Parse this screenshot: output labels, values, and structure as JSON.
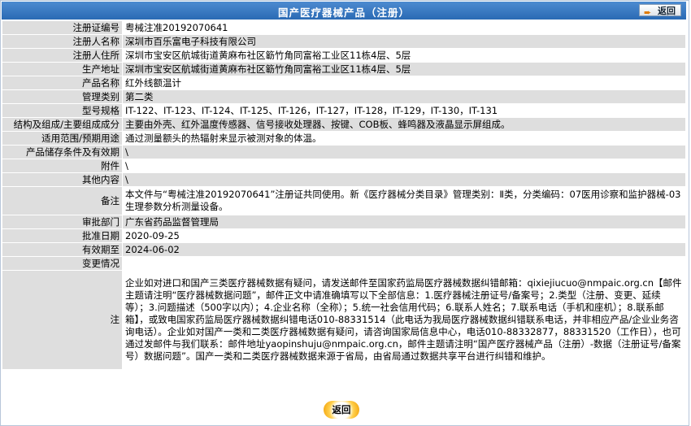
{
  "header": {
    "title": "国产医疗器械产品（注册）",
    "back_label": "返回"
  },
  "rows": [
    {
      "label": "注册证编号",
      "value": "粤械注准20192070641"
    },
    {
      "label": "注册人名称",
      "value": "深圳市百乐富电子科技有限公司"
    },
    {
      "label": "注册人住所",
      "value": "深圳市宝安区航城街道黄麻布社区簕竹角同富裕工业区11栋4层、5层"
    },
    {
      "label": "生产地址",
      "value": "深圳市宝安区航城街道黄麻布社区簕竹角同富裕工业区11栋4层、5层"
    },
    {
      "label": "产品名称",
      "value": "红外线额温计"
    },
    {
      "label": "管理类别",
      "value": "第二类"
    },
    {
      "label": "型号规格",
      "value": "IT-122、IT-123、IT-124、IT-125、IT-126，IT-127，IT-128，IT-129，IT-130，IT-131"
    },
    {
      "label": "结构及组成/主要组成成分",
      "value": "主要由外壳、红外温度传感器、信号接收处理器、按键、COB板、蜂鸣器及液晶显示屏组成。"
    },
    {
      "label": "适用范围/预期用途",
      "value": "通过测量额头的热辐射来显示被测对象的体温。"
    },
    {
      "label": "产品储存条件及有效期",
      "value": "\\"
    },
    {
      "label": "附件",
      "value": "\\"
    },
    {
      "label": "其他内容",
      "value": "\\"
    },
    {
      "label": "备注",
      "value": "本文件与“粤械注准20192070641”注册证共同使用。新《医疗器械分类目录》管理类别：Ⅱ类，分类编码：07医用诊察和监护器械-03生理参数分析测量设备。"
    },
    {
      "label": "审批部门",
      "value": "广东省药品监督管理局"
    },
    {
      "label": "批准日期",
      "value": "2020-09-25"
    },
    {
      "label": "有效期至",
      "value": "2024-06-02"
    },
    {
      "label": "变更情况",
      "value": ""
    }
  ],
  "note": {
    "label": "注",
    "text": "企业如对进口和国产三类医疗器械数据有疑问，请发送邮件至国家药监局医疗器械数据纠错邮箱：qixiejiucuo@nmpaic.org.cn【邮件主题请注明“医疗器械数据问题”，邮件正文中请准确填写以下全部信息：1.医疗器械注册证号/备案号；2.类型（注册、变更、延续等）；3.问题描述（500字以内）；4.企业名称（全称）；5.统一社会信用代码；6.联系人姓名；7.联系电话（手机和座机）；8.联系邮箱】，或致电国家药监局医疗器械数据纠错电话010-88331514（此电话为我局医疗器械数据纠错联系电话，并非相应产品/企业业务咨询电话）。企业如对国产一类和二类医疗器械数据有疑问，请咨询国家局信息中心，电话010-88332877，88331520（工作日），也可通过发邮件与我们联系：邮件地址yaopinshuju@nmpaic.org.cn，邮件主题请注明“国产医疗器械产品（注册）-数据（注册证号/备案号）数据问题”。国产一类和二类医疗器械数据来源于省局，由省局通过数据共享平台进行纠错和维护。"
  },
  "footer": {
    "back_label": "返回"
  },
  "colors": {
    "header_bg": "#2a6ab4",
    "label_bg": "#dedede",
    "button_accent": "#f19b00"
  }
}
